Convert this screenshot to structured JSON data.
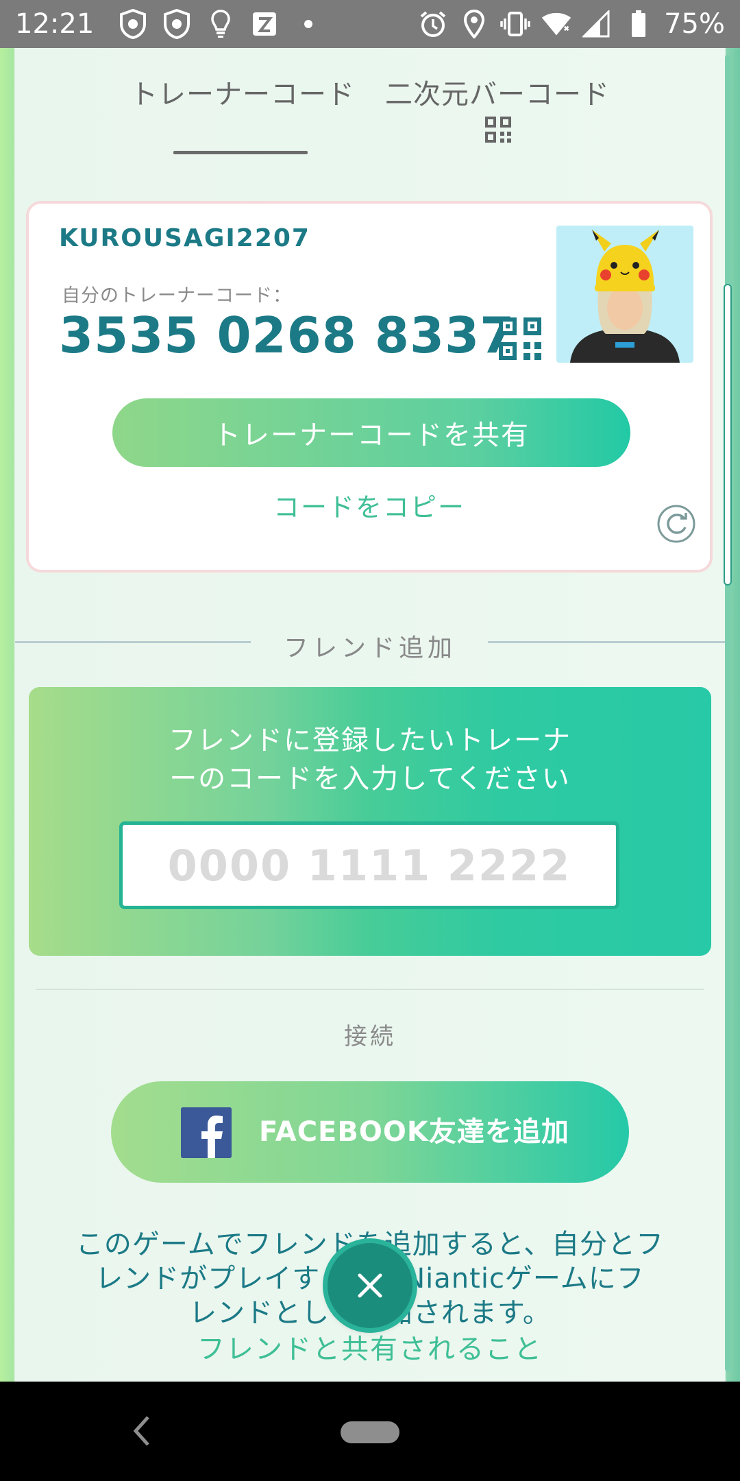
{
  "status_bar": {
    "time": "12:21",
    "battery_percent": "75%",
    "icons": [
      "shield-icon",
      "shield-icon",
      "lightbulb-icon",
      "app-icon",
      "dot-icon",
      "alarm-icon",
      "location-icon",
      "vibrate-icon",
      "wifi-icon",
      "signal-icon",
      "battery-icon"
    ]
  },
  "tabs": [
    {
      "label": "トレーナーコード",
      "active": true
    },
    {
      "label": "二次元バーコード",
      "active": false
    }
  ],
  "trainer_card": {
    "name": "KUROUSAGI2207",
    "code_label": "自分のトレーナーコード：",
    "code": "3535 0268 8337",
    "share_label": "トレーナーコードを共有",
    "copy_label": "コードをコピー"
  },
  "friend_section": {
    "divider_label": "フレンド追加",
    "prompt_line1": "フレンドに登録したいトレーナ",
    "prompt_line2": "ーのコードを入力してください",
    "input_placeholder": "0000 1111 2222",
    "input_value": ""
  },
  "connect": {
    "label": "接続",
    "facebook_label": "FACEBOOK友達を追加"
  },
  "info": {
    "line1": "このゲームでフレンドを追加すると、自分とフ",
    "line2": "レンドがプレイする他のNianticゲームにフ",
    "line3": "レンドとして追加されます。",
    "link": "フレンドと共有されること"
  },
  "colors": {
    "accent_teal": "#1c7a86",
    "accent_green": "#3fbf96",
    "facebook_blue": "#3b5998"
  }
}
